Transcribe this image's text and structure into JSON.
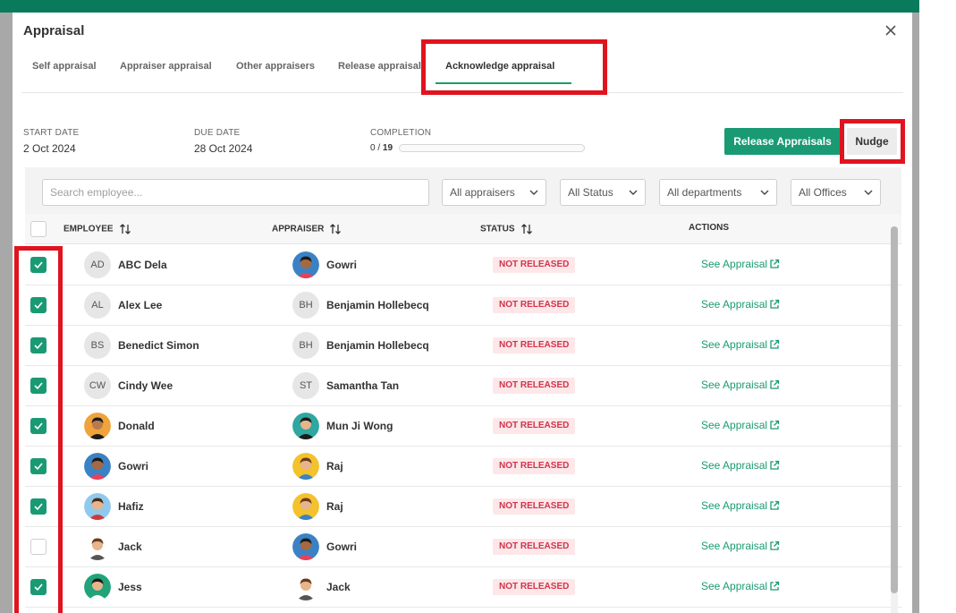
{
  "modal": {
    "title": "Appraisal",
    "tabs": [
      {
        "label": "Self appraisal"
      },
      {
        "label": "Appraiser appraisal"
      },
      {
        "label": "Other appraisers"
      },
      {
        "label": "Release appraisal"
      },
      {
        "label": "Acknowledge appraisal",
        "active": true
      }
    ]
  },
  "summary": {
    "start_label": "START DATE",
    "start_value": "2 Oct 2024",
    "due_label": "DUE DATE",
    "due_value": "28 Oct 2024",
    "completion_label": "COMPLETION",
    "completion_done": "0",
    "completion_total": "19",
    "completion_fraction": 0
  },
  "actions": {
    "release_label": "Release Appraisals",
    "nudge_label": "Nudge"
  },
  "filters": {
    "search_placeholder": "Search employee...",
    "appraisers": "All appraisers",
    "status": "All Status",
    "departments": "All departments",
    "offices": "All Offices"
  },
  "table": {
    "headers": {
      "employee": "EMPLOYEE",
      "appraiser": "APPRAISER",
      "status": "STATUS",
      "actions": "ACTIONS"
    },
    "rows": [
      {
        "checked": true,
        "employee": "ABC Dela",
        "emp_initials": "AD",
        "emp_avatar": "initials",
        "appraiser": "Gowri",
        "apr_initials": "",
        "apr_avatar": "woman-blue",
        "status": "NOT RELEASED",
        "action": "See Appraisal"
      },
      {
        "checked": true,
        "employee": "Alex Lee",
        "emp_initials": "AL",
        "emp_avatar": "initials",
        "appraiser": "Benjamin Hollebecq",
        "apr_initials": "BH",
        "apr_avatar": "initials",
        "status": "NOT RELEASED",
        "action": "See Appraisal"
      },
      {
        "checked": true,
        "employee": "Benedict Simon",
        "emp_initials": "BS",
        "emp_avatar": "initials",
        "appraiser": "Benjamin Hollebecq",
        "apr_initials": "BH",
        "apr_avatar": "initials",
        "status": "NOT RELEASED",
        "action": "See Appraisal"
      },
      {
        "checked": true,
        "employee": "Cindy Wee",
        "emp_initials": "CW",
        "emp_avatar": "initials",
        "appraiser": "Samantha Tan",
        "apr_initials": "ST",
        "apr_avatar": "initials",
        "status": "NOT RELEASED",
        "action": "See Appraisal"
      },
      {
        "checked": true,
        "employee": "Donald",
        "emp_initials": "",
        "emp_avatar": "man-orange",
        "appraiser": "Mun Ji Wong",
        "apr_initials": "",
        "apr_avatar": "woman-teal",
        "status": "NOT RELEASED",
        "action": "See Appraisal"
      },
      {
        "checked": true,
        "employee": "Gowri",
        "emp_initials": "",
        "emp_avatar": "woman-blue",
        "appraiser": "Raj",
        "apr_initials": "",
        "apr_avatar": "man-yellow",
        "status": "NOT RELEASED",
        "action": "See Appraisal"
      },
      {
        "checked": true,
        "employee": "Hafiz",
        "emp_initials": "",
        "emp_avatar": "man-lightblue",
        "appraiser": "Raj",
        "apr_initials": "",
        "apr_avatar": "man-yellow",
        "status": "NOT RELEASED",
        "action": "See Appraisal"
      },
      {
        "checked": false,
        "employee": "Jack",
        "emp_initials": "",
        "emp_avatar": "man-white",
        "appraiser": "Gowri",
        "apr_initials": "",
        "apr_avatar": "woman-blue",
        "status": "NOT RELEASED",
        "action": "See Appraisal"
      },
      {
        "checked": true,
        "employee": "Jess",
        "emp_initials": "",
        "emp_avatar": "woman-green",
        "appraiser": "Jack",
        "apr_initials": "",
        "apr_avatar": "man-white",
        "status": "NOT RELEASED",
        "action": "See Appraisal"
      }
    ]
  },
  "colors": {
    "accent": "#1a9a73",
    "status_text": "#d0344a",
    "status_bg": "#fde7e9",
    "annotation": "#e0141e"
  }
}
